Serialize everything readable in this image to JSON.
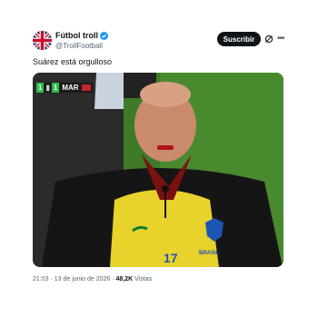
{
  "author": {
    "name": "Fútbol troll",
    "handle": "@TrollFootball"
  },
  "actions": {
    "follow_label": "Suscribir",
    "grok_icon": "grok-icon",
    "more_icon": "more-icon"
  },
  "tweet": {
    "text": "Suárez está orgulloso"
  },
  "media": {
    "scoreboard": {
      "home_score": "1",
      "away_score": "1",
      "away_team": "MAR"
    },
    "shirt_number": "17",
    "shirt_text": "BRASIL"
  },
  "meta": {
    "time": "21:03",
    "separator": "·",
    "date": "13 de junio de 2026",
    "views_count": "48,2K",
    "views_label": "Vistas"
  },
  "colors": {
    "follow_bg": "#0f1419",
    "verified": "#1d9bf0",
    "secondary_text": "#536471"
  }
}
